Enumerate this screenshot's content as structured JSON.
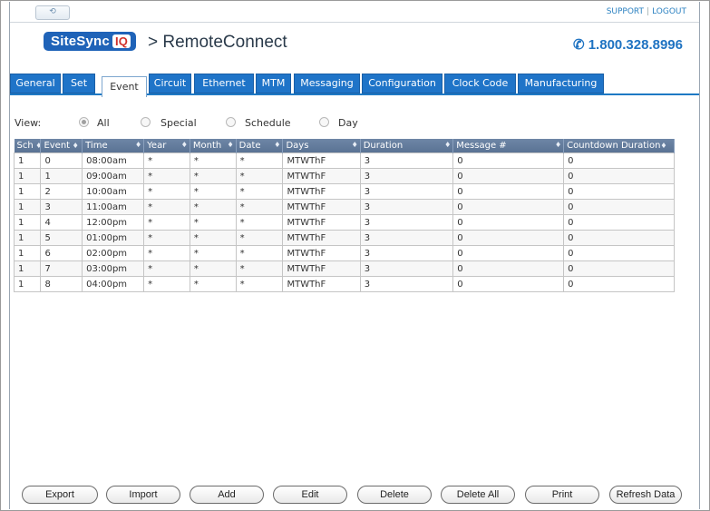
{
  "header": {
    "site_button": "⟲",
    "support_link": "SUPPORT",
    "logout_link": "LOGOUT",
    "logo_text": "SiteSync",
    "logo_iq": "IQ",
    "product_name": "> RemoteConnect",
    "phone": "1.800.328.8996"
  },
  "tabs": [
    {
      "label": "General",
      "active": false
    },
    {
      "label": "Set",
      "active": false
    },
    {
      "label": "Event",
      "active": true
    },
    {
      "label": "Circuit",
      "active": false
    },
    {
      "label": "Ethernet",
      "active": false
    },
    {
      "label": "MTM",
      "active": false
    },
    {
      "label": "Messaging",
      "active": false
    },
    {
      "label": "Configuration",
      "active": false
    },
    {
      "label": "Clock Code",
      "active": false
    },
    {
      "label": "Manufacturing",
      "active": false
    }
  ],
  "view": {
    "label": "View:",
    "options": [
      {
        "label": "All",
        "selected": true
      },
      {
        "label": "Special",
        "selected": false
      },
      {
        "label": "Schedule",
        "selected": false
      },
      {
        "label": "Day",
        "selected": false
      }
    ]
  },
  "table": {
    "columns": [
      "Sch",
      "Event",
      "Time",
      "Year",
      "Month",
      "Date",
      "Days",
      "Duration",
      "Message #",
      "Countdown Duration"
    ],
    "rows": [
      [
        "1",
        "0",
        "08:00am",
        "*",
        "*",
        "*",
        "MTWThF",
        "3",
        "0",
        "0"
      ],
      [
        "1",
        "1",
        "09:00am",
        "*",
        "*",
        "*",
        "MTWThF",
        "3",
        "0",
        "0"
      ],
      [
        "1",
        "2",
        "10:00am",
        "*",
        "*",
        "*",
        "MTWThF",
        "3",
        "0",
        "0"
      ],
      [
        "1",
        "3",
        "11:00am",
        "*",
        "*",
        "*",
        "MTWThF",
        "3",
        "0",
        "0"
      ],
      [
        "1",
        "4",
        "12:00pm",
        "*",
        "*",
        "*",
        "MTWThF",
        "3",
        "0",
        "0"
      ],
      [
        "1",
        "5",
        "01:00pm",
        "*",
        "*",
        "*",
        "MTWThF",
        "3",
        "0",
        "0"
      ],
      [
        "1",
        "6",
        "02:00pm",
        "*",
        "*",
        "*",
        "MTWThF",
        "3",
        "0",
        "0"
      ],
      [
        "1",
        "7",
        "03:00pm",
        "*",
        "*",
        "*",
        "MTWThF",
        "3",
        "0",
        "0"
      ],
      [
        "1",
        "8",
        "04:00pm",
        "*",
        "*",
        "*",
        "MTWThF",
        "3",
        "0",
        "0"
      ]
    ]
  },
  "buttons": [
    "Export",
    "Import",
    "Add",
    "Edit",
    "Delete",
    "Delete All",
    "Print",
    "Refresh Data"
  ],
  "icons": {
    "sort": "sort-arrows-icon",
    "phone": "phone-icon",
    "radio": "radio-icon"
  },
  "colors": {
    "tab_blue": "#1f74c8",
    "header_blue": "#5f7898",
    "brand_blue": "#1f63b8",
    "link_blue": "#2b81c1"
  }
}
